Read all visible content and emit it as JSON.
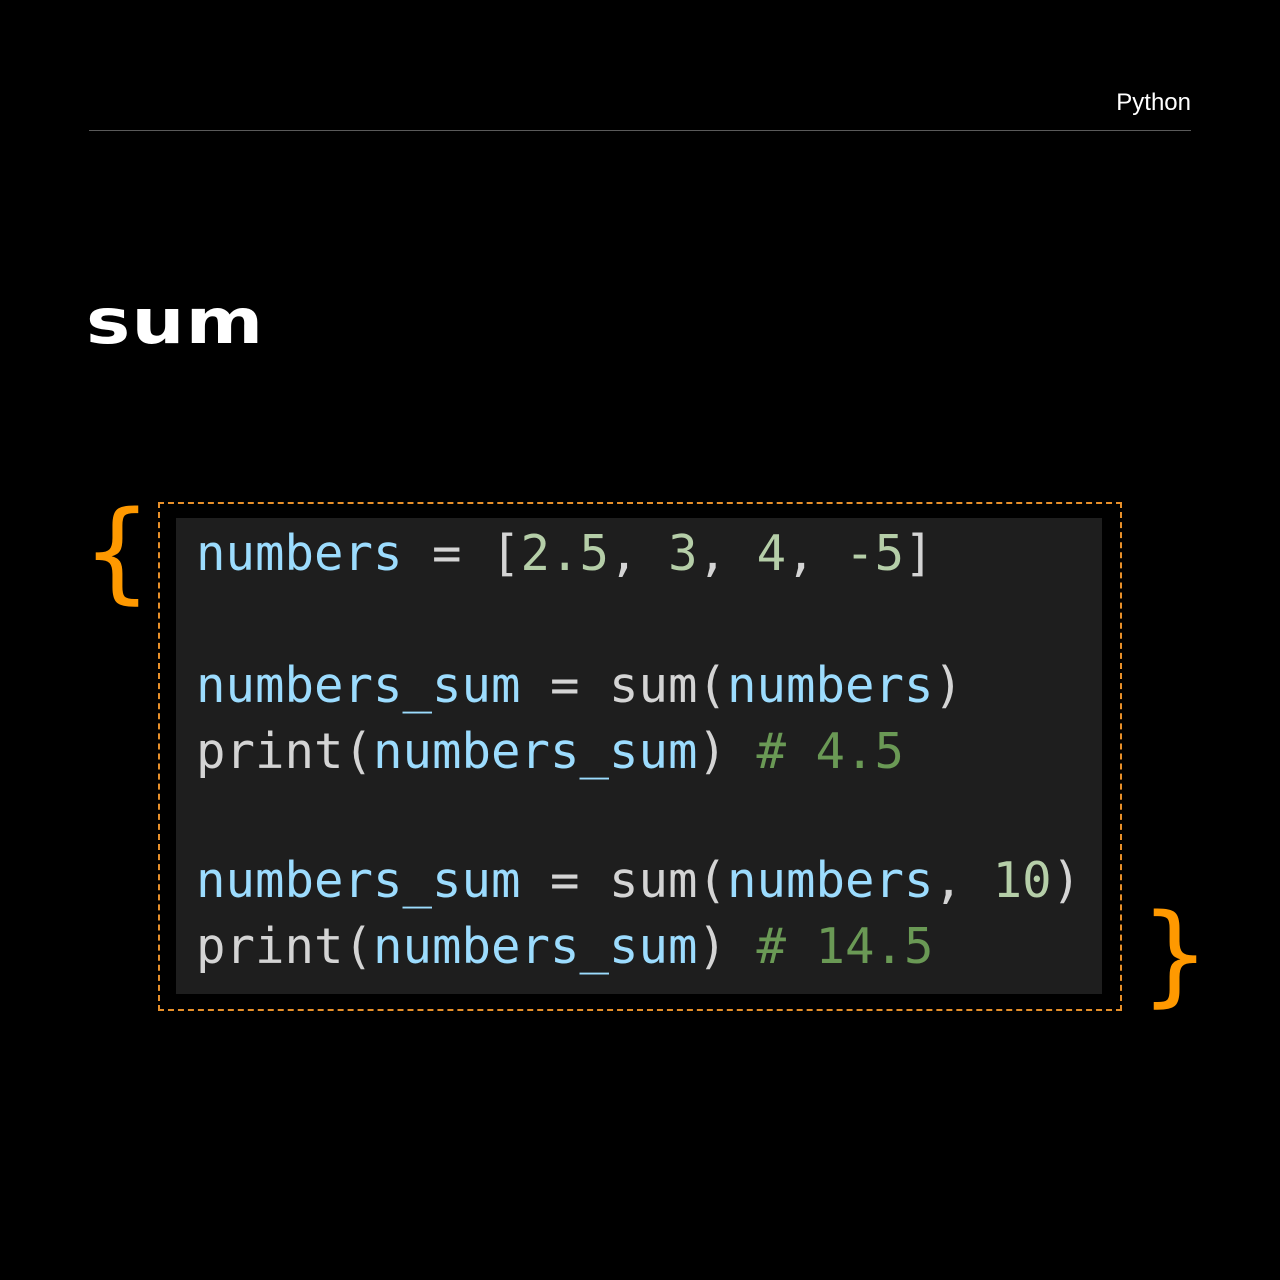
{
  "header": {
    "topic": "Python"
  },
  "title": "sum",
  "braces": {
    "open": "{",
    "close": "}"
  },
  "colors": {
    "accent": "#ff9900",
    "frame_dash": "#e8902a",
    "code_background": "#1e1e1e",
    "variable": "#9cdcfe",
    "function": "#d4d4d4",
    "number": "#b5cea8",
    "comment": "#6a9955"
  },
  "code": {
    "line1": {
      "var": "numbers",
      "assign": " = [",
      "n1": "2.5",
      "sep1": ", ",
      "n2": "3",
      "sep2": ", ",
      "n3": "4",
      "sep3": ", ",
      "n4": "-5",
      "close": "]"
    },
    "line3": {
      "var": "numbers_sum",
      "assign": " = ",
      "fn": "sum(",
      "arg": "numbers",
      "close": ")"
    },
    "line4": {
      "fn": "print(",
      "arg": "numbers_sum",
      "close": ") ",
      "comment": "# 4.5"
    },
    "line6": {
      "var": "numbers_sum",
      "assign": " = ",
      "fn": "sum(",
      "arg": "numbers",
      "sep": ", ",
      "num": "10",
      "close": ")"
    },
    "line7": {
      "fn": "print(",
      "arg": "numbers_sum",
      "close": ") ",
      "comment": "# 14.5"
    }
  }
}
